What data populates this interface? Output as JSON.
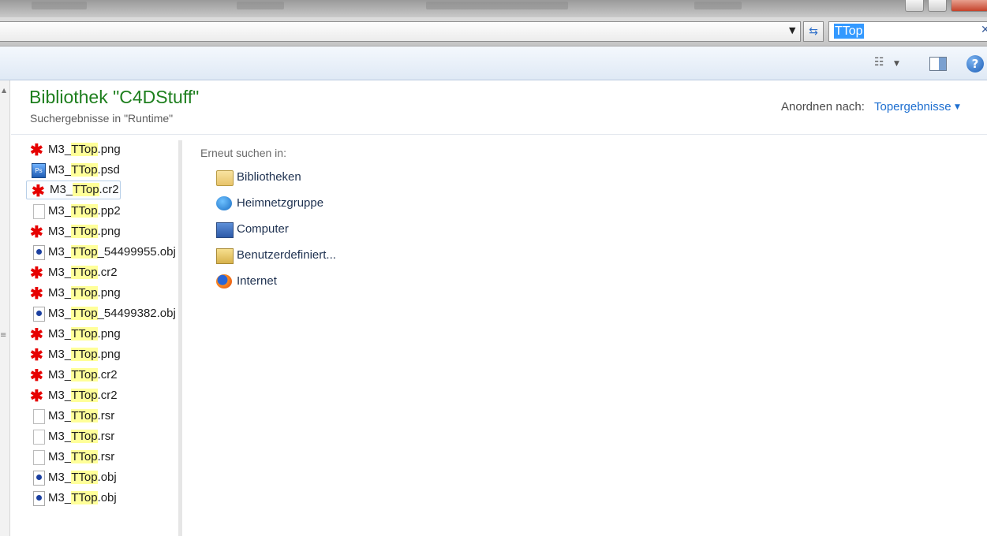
{
  "address_bar": {
    "search_value": "TTop"
  },
  "library": {
    "title": "Bibliothek \"C4DStuff\"",
    "subtitle": "Suchergebnisse in \"Runtime\"",
    "arrange_label": "Anordnen nach:",
    "arrange_value": "Topergebnisse"
  },
  "files": [
    {
      "prefix": "M3_",
      "match": "TTop",
      "suffix": ".png",
      "icon": "png-file-icon"
    },
    {
      "prefix": "M3_",
      "match": "TTop",
      "suffix": ".psd",
      "icon": "psd-file-icon"
    },
    {
      "prefix": "M3_",
      "match": "TTop",
      "suffix": ".cr2",
      "icon": "png-file-icon"
    },
    {
      "prefix": "M3_",
      "match": "TTop",
      "suffix": ".pp2",
      "icon": "generic-file-icon"
    },
    {
      "prefix": "M3_",
      "match": "TTop",
      "suffix": ".png",
      "icon": "png-file-icon"
    },
    {
      "prefix": "M3_",
      "match": "TTop",
      "suffix": "_54499955.obj",
      "icon": "obj-file-icon"
    },
    {
      "prefix": "M3_",
      "match": "TTop",
      "suffix": ".cr2",
      "icon": "png-file-icon"
    },
    {
      "prefix": "M3_",
      "match": "TTop",
      "suffix": ".png",
      "icon": "png-file-icon"
    },
    {
      "prefix": "M3_",
      "match": "TTop",
      "suffix": "_54499382.obj",
      "icon": "obj-file-icon"
    },
    {
      "prefix": "M3_",
      "match": "TTop",
      "suffix": ".png",
      "icon": "png-file-icon"
    },
    {
      "prefix": "M3_",
      "match": "TTop",
      "suffix": ".png",
      "icon": "png-file-icon"
    },
    {
      "prefix": "M3_",
      "match": "TTop",
      "suffix": ".cr2",
      "icon": "png-file-icon"
    },
    {
      "prefix": "M3_",
      "match": "TTop",
      "suffix": ".cr2",
      "icon": "png-file-icon"
    },
    {
      "prefix": "M3_",
      "match": "TTop",
      "suffix": ".rsr",
      "icon": "generic-file-icon"
    },
    {
      "prefix": "M3_",
      "match": "TTop",
      "suffix": ".rsr",
      "icon": "generic-file-icon"
    },
    {
      "prefix": "M3_",
      "match": "TTop",
      "suffix": ".rsr",
      "icon": "generic-file-icon"
    },
    {
      "prefix": "M3_",
      "match": "TTop",
      "suffix": ".obj",
      "icon": "obj-file-icon"
    },
    {
      "prefix": "M3_",
      "match": "TTop",
      "suffix": ".obj",
      "icon": "obj-file-icon"
    }
  ],
  "search_again": {
    "label": "Erneut suchen in:",
    "locations": [
      {
        "label": "Bibliotheken",
        "icon": "libraries-icon"
      },
      {
        "label": "Heimnetzgruppe",
        "icon": "homegroup-icon"
      },
      {
        "label": "Computer",
        "icon": "computer-icon"
      },
      {
        "label": "Benutzerdefiniert...",
        "icon": "custom-folder-icon"
      },
      {
        "label": "Internet",
        "icon": "internet-icon"
      }
    ]
  }
}
